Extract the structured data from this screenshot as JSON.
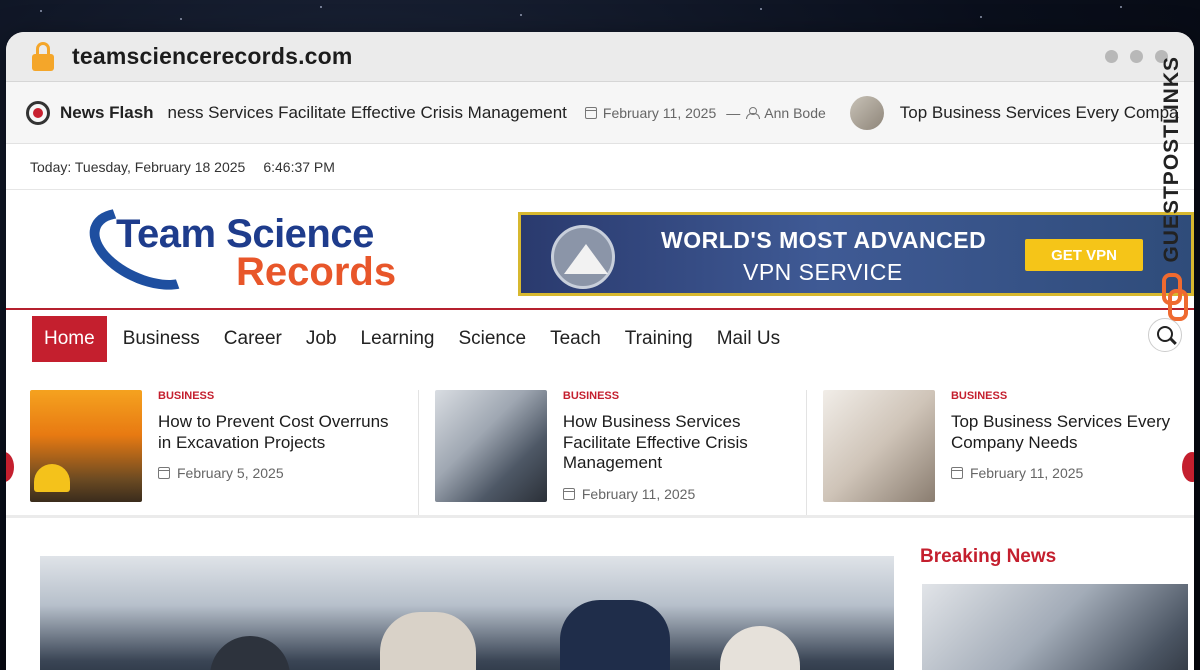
{
  "browser": {
    "url": "teamsciencerecords.com"
  },
  "ticker": {
    "label": "News Flash",
    "headline": "ness Services Facilitate Effective Crisis Management",
    "date": "February 11, 2025",
    "author": "Ann Bode",
    "next_headline": "Top Business Services Every Compa"
  },
  "datebar": {
    "today": "Today: Tuesday, February 18 2025",
    "time": "6:46:37 PM"
  },
  "logo": {
    "line1": "Team Science",
    "line2": "Records"
  },
  "banner": {
    "line1": "WORLD'S MOST ADVANCED",
    "line2": "VPN SERVICE",
    "cta": "GET VPN"
  },
  "nav": {
    "items": [
      "Home",
      "Business",
      "Career",
      "Job",
      "Learning",
      "Science",
      "Teach",
      "Training",
      "Mail Us"
    ],
    "active": "Home"
  },
  "cards": [
    {
      "category": "BUSINESS",
      "title": "How to Prevent Cost Overruns in Excavation Projects",
      "date": "February 5, 2025"
    },
    {
      "category": "BUSINESS",
      "title": "How Business Services Facilitate Effective Crisis Management",
      "date": "February 11, 2025"
    },
    {
      "category": "BUSINESS",
      "title": "Top Business Services Every Company Needs",
      "date": "February 11, 2025"
    }
  ],
  "sidebar": {
    "breaking_title": "Breaking News"
  },
  "watermark": {
    "text": "GUESTPOSTLINKS"
  },
  "colors": {
    "accent": "#c41f2e",
    "logo_blue": "#1e3c8c",
    "logo_orange": "#e8562a",
    "banner_cta": "#f5c518",
    "lock": "#f4a62a"
  }
}
